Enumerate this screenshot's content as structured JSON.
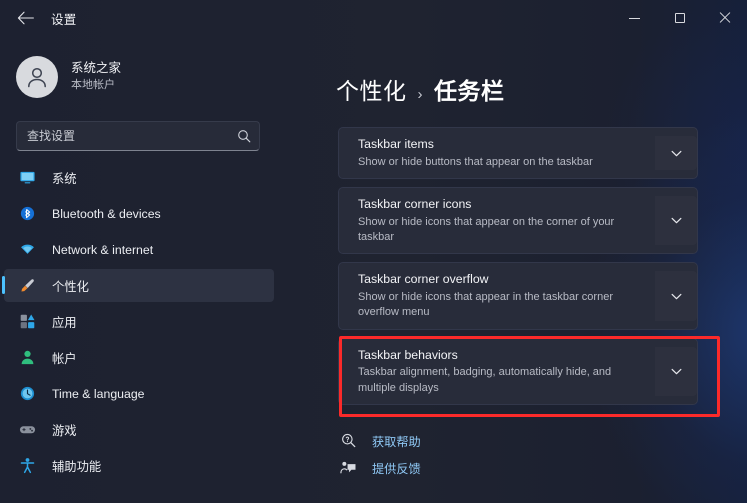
{
  "window": {
    "title": "设置",
    "back_icon": "back-arrow-icon",
    "controls": {
      "minimize": "minimize-icon",
      "maximize": "maximize-icon",
      "close": "close-icon"
    }
  },
  "account": {
    "name": "系统之家",
    "type": "本地帐户",
    "avatar_icon": "user-avatar-icon"
  },
  "search": {
    "placeholder": "查找设置",
    "value": "",
    "icon": "search-icon"
  },
  "sidebar": {
    "items": [
      {
        "label": "系统",
        "icon": "monitor-icon",
        "selected": false
      },
      {
        "label": "Bluetooth & devices",
        "icon": "bluetooth-icon",
        "selected": false
      },
      {
        "label": "Network & internet",
        "icon": "wifi-icon",
        "selected": false
      },
      {
        "label": "个性化",
        "icon": "paintbrush-icon",
        "selected": true
      },
      {
        "label": "应用",
        "icon": "apps-icon",
        "selected": false
      },
      {
        "label": "帐户",
        "icon": "account-icon",
        "selected": false
      },
      {
        "label": "Time & language",
        "icon": "clock-icon",
        "selected": false
      },
      {
        "label": "游戏",
        "icon": "gamepad-icon",
        "selected": false
      },
      {
        "label": "辅助功能",
        "icon": "accessibility-icon",
        "selected": false
      }
    ]
  },
  "main": {
    "breadcrumb": {
      "parent": "个性化",
      "separator": "›",
      "current": "任务栏"
    },
    "cards": [
      {
        "title": "Taskbar items",
        "subtitle": "Show or hide buttons that appear on the taskbar",
        "chevron": "chevron-down-icon",
        "highlighted": false
      },
      {
        "title": "Taskbar corner icons",
        "subtitle": "Show or hide icons that appear on the corner of your taskbar",
        "chevron": "chevron-down-icon",
        "highlighted": false
      },
      {
        "title": "Taskbar corner overflow",
        "subtitle": "Show or hide icons that appear in the taskbar corner overflow menu",
        "chevron": "chevron-down-icon",
        "highlighted": false
      },
      {
        "title": "Taskbar behaviors",
        "subtitle": "Taskbar alignment, badging, automatically hide, and multiple displays",
        "chevron": "chevron-down-icon",
        "highlighted": true
      }
    ],
    "links": [
      {
        "label": "获取帮助",
        "icon": "help-icon"
      },
      {
        "label": "提供反馈",
        "icon": "feedback-icon"
      }
    ]
  },
  "colors": {
    "accent": "#4cc2ff",
    "link": "#8fc8f5",
    "highlight_border": "#fb2a2a",
    "background": "#202431",
    "card": "#282c3a"
  }
}
